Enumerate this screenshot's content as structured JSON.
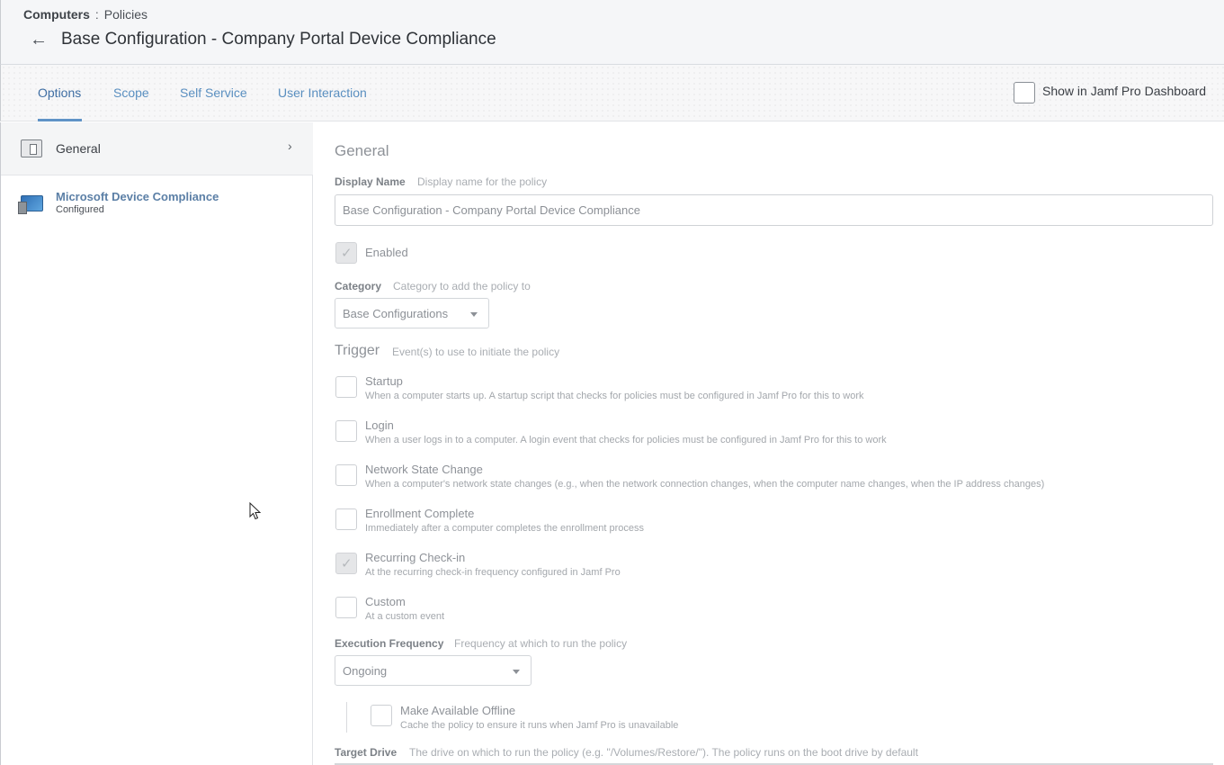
{
  "breadcrumb": {
    "section": "Computers",
    "separator": ":",
    "page": "Policies"
  },
  "page_title": "Base Configuration - Company Portal Device Compliance",
  "tabs": [
    {
      "label": "Options",
      "active": true
    },
    {
      "label": "Scope",
      "active": false
    },
    {
      "label": "Self Service",
      "active": false
    },
    {
      "label": "User Interaction",
      "active": false
    }
  ],
  "dashboard_toggle": {
    "label": "Show in Jamf Pro Dashboard",
    "checked": false
  },
  "sidebar": {
    "items": [
      {
        "label": "General",
        "icon": "general-icon"
      },
      {
        "label": "Microsoft Device Compliance",
        "sub": "Configured",
        "icon": "device-compliance-icon"
      }
    ]
  },
  "general": {
    "section_title": "General",
    "display_name": {
      "label": "Display Name",
      "hint": "Display name for the policy",
      "value": "Base Configuration - Company Portal Device Compliance"
    },
    "enabled": {
      "label": "Enabled",
      "checked": true
    },
    "category": {
      "label": "Category",
      "hint": "Category to add the policy to",
      "value": "Base Configurations"
    },
    "trigger": {
      "label": "Trigger",
      "hint": "Event(s) to use to initiate the policy",
      "options": [
        {
          "label": "Startup",
          "desc": "When a computer starts up. A startup script that checks for policies must be configured in Jamf Pro for this to work",
          "checked": false
        },
        {
          "label": "Login",
          "desc": "When a user logs in to a computer. A login event that checks for policies must be configured in Jamf Pro for this to work",
          "checked": false
        },
        {
          "label": "Network State Change",
          "desc": "When a computer's network state changes (e.g., when the network connection changes, when the computer name changes, when the IP address changes)",
          "checked": false
        },
        {
          "label": "Enrollment Complete",
          "desc": "Immediately after a computer completes the enrollment process",
          "checked": false
        },
        {
          "label": "Recurring Check-in",
          "desc": "At the recurring check-in frequency configured in Jamf Pro",
          "checked": true
        },
        {
          "label": "Custom",
          "desc": "At a custom event",
          "checked": false
        }
      ]
    },
    "execution_frequency": {
      "label": "Execution Frequency",
      "hint": "Frequency at which to run the policy",
      "value": "Ongoing"
    },
    "offline": {
      "label": "Make Available Offline",
      "desc": "Cache the policy to ensure it runs when Jamf Pro is unavailable",
      "checked": false
    },
    "target_drive": {
      "label": "Target Drive",
      "hint": "The drive on which to run the policy (e.g. \"/Volumes/Restore/\"). The policy runs on the boot drive by default"
    }
  }
}
